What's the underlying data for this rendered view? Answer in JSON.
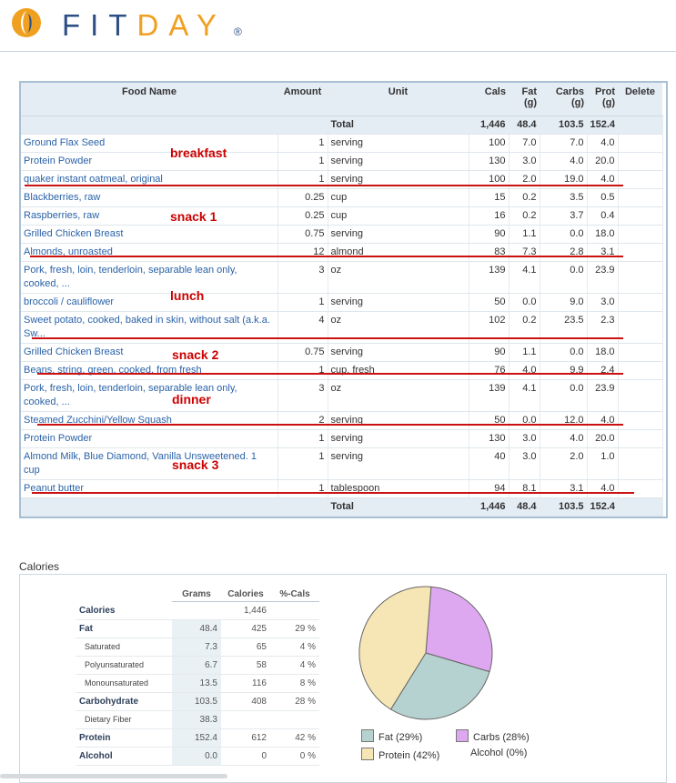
{
  "brand": {
    "part1": "FIT",
    "part2": "DAY",
    "reg": "®"
  },
  "food_table": {
    "headers": [
      "Food Name",
      "Amount",
      "Unit",
      "Cals",
      "Fat (g)",
      "Carbs (g)",
      "Prot (g)",
      "Delete"
    ],
    "total_label": "Total",
    "totals": {
      "cals": "1,446",
      "fat": "48.4",
      "carbs": "103.5",
      "prot": "152.4"
    },
    "rows": [
      {
        "name": "Ground Flax Seed",
        "amount": "1",
        "unit": "serving",
        "cals": "100",
        "fat": "7.0",
        "carbs": "7.0",
        "prot": "4.0"
      },
      {
        "name": "Protein Powder",
        "amount": "1",
        "unit": "serving",
        "cals": "130",
        "fat": "3.0",
        "carbs": "4.0",
        "prot": "20.0"
      },
      {
        "name": "quaker instant oatmeal, original",
        "amount": "1",
        "unit": "serving",
        "cals": "100",
        "fat": "2.0",
        "carbs": "19.0",
        "prot": "4.0"
      },
      {
        "name": "Blackberries, raw",
        "amount": "0.25",
        "unit": "cup",
        "cals": "15",
        "fat": "0.2",
        "carbs": "3.5",
        "prot": "0.5"
      },
      {
        "name": "Raspberries, raw",
        "amount": "0.25",
        "unit": "cup",
        "cals": "16",
        "fat": "0.2",
        "carbs": "3.7",
        "prot": "0.4"
      },
      {
        "name": "Grilled Chicken Breast",
        "amount": "0.75",
        "unit": "serving",
        "cals": "90",
        "fat": "1.1",
        "carbs": "0.0",
        "prot": "18.0"
      },
      {
        "name": "Almonds, unroasted",
        "amount": "12",
        "unit": "almond",
        "cals": "83",
        "fat": "7.3",
        "carbs": "2.8",
        "prot": "3.1"
      },
      {
        "name": "Pork, fresh, loin, tenderloin, separable lean only, cooked, ...",
        "amount": "3",
        "unit": "oz",
        "cals": "139",
        "fat": "4.1",
        "carbs": "0.0",
        "prot": "23.9"
      },
      {
        "name": "broccoli / cauliflower",
        "amount": "1",
        "unit": "serving",
        "cals": "50",
        "fat": "0.0",
        "carbs": "9.0",
        "prot": "3.0"
      },
      {
        "name": "Sweet potato, cooked, baked in skin, without salt (a.k.a. Sw...",
        "amount": "4",
        "unit": "oz",
        "cals": "102",
        "fat": "0.2",
        "carbs": "23.5",
        "prot": "2.3"
      },
      {
        "name": "Grilled Chicken Breast",
        "amount": "0.75",
        "unit": "serving",
        "cals": "90",
        "fat": "1.1",
        "carbs": "0.0",
        "prot": "18.0"
      },
      {
        "name": "Beans, string, green, cooked, from fresh",
        "amount": "1",
        "unit": "cup, fresh",
        "cals": "76",
        "fat": "4.0",
        "carbs": "9.9",
        "prot": "2.4"
      },
      {
        "name": "Pork, fresh, loin, tenderloin, separable lean only, cooked, ...",
        "amount": "3",
        "unit": "oz",
        "cals": "139",
        "fat": "4.1",
        "carbs": "0.0",
        "prot": "23.9"
      },
      {
        "name": "Steamed Zucchini/Yellow Squash",
        "amount": "2",
        "unit": "serving",
        "cals": "50",
        "fat": "0.0",
        "carbs": "12.0",
        "prot": "4.0"
      },
      {
        "name": "Protein Powder",
        "amount": "1",
        "unit": "serving",
        "cals": "130",
        "fat": "3.0",
        "carbs": "4.0",
        "prot": "20.0"
      },
      {
        "name": "Almond Milk, Blue Diamond, Vanilla Unsweetened. 1 cup",
        "amount": "1",
        "unit": "serving",
        "cals": "40",
        "fat": "3.0",
        "carbs": "2.0",
        "prot": "1.0"
      },
      {
        "name": "Peanut butter",
        "amount": "1",
        "unit": "tablespoon",
        "cals": "94",
        "fat": "8.1",
        "carbs": "3.1",
        "prot": "4.0"
      }
    ]
  },
  "meal_labels": {
    "breakfast": "breakfast",
    "snack1": "snack 1",
    "lunch": "lunch",
    "snack2": "snack 2",
    "dinner": "dinner",
    "snack3": "snack 3"
  },
  "annotation_color": "#cc0000",
  "calories_section": {
    "title": "Calories",
    "headers": [
      "Grams",
      "Calories",
      "%-Cals"
    ],
    "rows": [
      {
        "label": "Calories",
        "grams": "",
        "calories": "1,446",
        "pct": "",
        "sub": false
      },
      {
        "label": "Fat",
        "grams": "48.4",
        "calories": "425",
        "pct": "29 %",
        "sub": false
      },
      {
        "label": "Saturated",
        "grams": "7.3",
        "calories": "65",
        "pct": "4 %",
        "sub": true
      },
      {
        "label": "Polyunsaturated",
        "grams": "6.7",
        "calories": "58",
        "pct": "4 %",
        "sub": true
      },
      {
        "label": "Monounsaturated",
        "grams": "13.5",
        "calories": "116",
        "pct": "8 %",
        "sub": true
      },
      {
        "label": "Carbohydrate",
        "grams": "103.5",
        "calories": "408",
        "pct": "28 %",
        "sub": false
      },
      {
        "label": "Dietary Fiber",
        "grams": "38.3",
        "calories": "",
        "pct": "",
        "sub": true
      },
      {
        "label": "Protein",
        "grams": "152.4",
        "calories": "612",
        "pct": "42 %",
        "sub": false
      },
      {
        "label": "Alcohol",
        "grams": "0.0",
        "calories": "0",
        "pct": "0 %",
        "sub": false
      }
    ]
  },
  "chart_data": {
    "type": "pie",
    "title": "",
    "slices": [
      {
        "name": "Carbs (28%)",
        "value": 28,
        "color": "#dda8f0"
      },
      {
        "name": "Fat (29%)",
        "value": 29,
        "color": "#b5d2d0"
      },
      {
        "name": "Protein (42%)",
        "value": 42,
        "color": "#f6e6b6"
      },
      {
        "name": "Alcohol (0%)",
        "value": 0,
        "color": "#ffffff"
      }
    ],
    "legend": [
      {
        "label": "Fat (29%)",
        "color": "#b5d2d0",
        "swatch": true
      },
      {
        "label": "Carbs (28%)",
        "color": "#dda8f0",
        "swatch": true
      },
      {
        "label": "Protein (42%)",
        "color": "#f6e6b6",
        "swatch": true
      },
      {
        "label": "Alcohol (0%)",
        "color": "",
        "swatch": false
      }
    ]
  }
}
